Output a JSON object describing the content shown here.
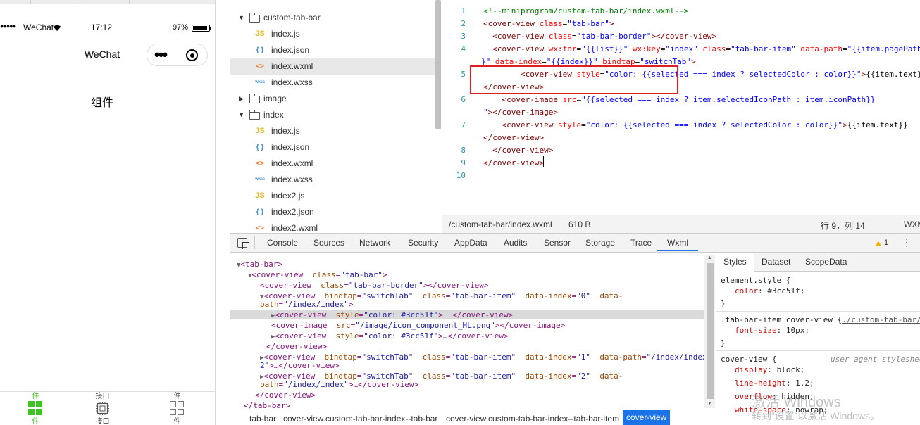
{
  "simulator": {
    "status": {
      "signal": "●●●●●",
      "carrier": "WeChat",
      "time": "17:12",
      "battery": "97%"
    },
    "nav_title": "WeChat",
    "page_text": "组件",
    "tabbar": [
      {
        "top": "件",
        "bottom": "件",
        "icon": "grid-icon",
        "active": true
      },
      {
        "top": "接口",
        "bottom": "接口",
        "icon": "chip-icon",
        "active": false
      },
      {
        "top": "件",
        "bottom": "件",
        "icon": "grid-icon",
        "active": false
      }
    ],
    "accent": "#3cc51f"
  },
  "file_tree": {
    "items": [
      {
        "label": "custom-tab-bar",
        "kind": "folder",
        "expanded": true
      },
      {
        "label": "index.js",
        "kind": "js",
        "badge": "JS"
      },
      {
        "label": "index.json",
        "kind": "json",
        "badge": "{ }"
      },
      {
        "label": "index.wxml",
        "kind": "wxml",
        "badge": "<>",
        "selected": true
      },
      {
        "label": "index.wxss",
        "kind": "wxss",
        "badge": "wxss"
      },
      {
        "label": "image",
        "kind": "folder",
        "expanded": false
      },
      {
        "label": "index",
        "kind": "folder",
        "expanded": true
      },
      {
        "label": "index.js",
        "kind": "js",
        "badge": "JS"
      },
      {
        "label": "index.json",
        "kind": "json",
        "badge": "{ }"
      },
      {
        "label": "index.wxml",
        "kind": "wxml",
        "badge": "<>"
      },
      {
        "label": "index.wxss",
        "kind": "wxss",
        "badge": "wxss"
      },
      {
        "label": "index2.js",
        "kind": "js",
        "badge": "JS"
      },
      {
        "label": "index2.json",
        "kind": "json",
        "badge": "{ }"
      },
      {
        "label": "index2.wxml",
        "kind": "wxml",
        "badge": "<>"
      }
    ]
  },
  "editor": {
    "line_numbers": [
      "1",
      "2",
      "3",
      "4",
      "5",
      "6",
      "7",
      "8",
      "9",
      "10"
    ],
    "status": {
      "path": "/custom-tab-bar/index.wxml",
      "size": "610 B",
      "position": "行 9，列 14",
      "lang": "WXM"
    }
  },
  "devtools": {
    "tabs": [
      "Console",
      "Sources",
      "Network",
      "Security",
      "AppData",
      "Audits",
      "Sensor",
      "Storage",
      "Trace",
      "Wxml"
    ],
    "active_tab": "Wxml",
    "warning_count": "1",
    "breadcrumb": [
      "tab-bar",
      "cover-view.custom-tab-bar-index--tab-bar",
      "cover-view.custom-tab-bar-index--tab-bar-item",
      "cover-view"
    ],
    "styles_tabs": [
      "Styles",
      "Dataset",
      "ScopeData"
    ],
    "styles": {
      "element_selector": "element.style {",
      "element_prop": "color",
      "element_val": "#3cc51f;",
      "rule2_selector": ".tab-bar-item cover-view {",
      "rule2_link": "./custom-tab-bar/",
      "rule2_prop": "font-size",
      "rule2_val": "10px;",
      "rule3_selector": "cover-view {",
      "rule3_source": "user agent styleshee",
      "rule3_props": [
        {
          "p": "display",
          "v": "block;"
        },
        {
          "p": "line-height",
          "v": "1.2;"
        },
        {
          "p": "overflow",
          "v": "hidden;"
        },
        {
          "p": "white-space",
          "v": "nowrap;"
        }
      ],
      "close": "}"
    }
  },
  "watermark": {
    "line1": "激活 Windows",
    "line2": "转到“设置”以激活 Windows。"
  }
}
